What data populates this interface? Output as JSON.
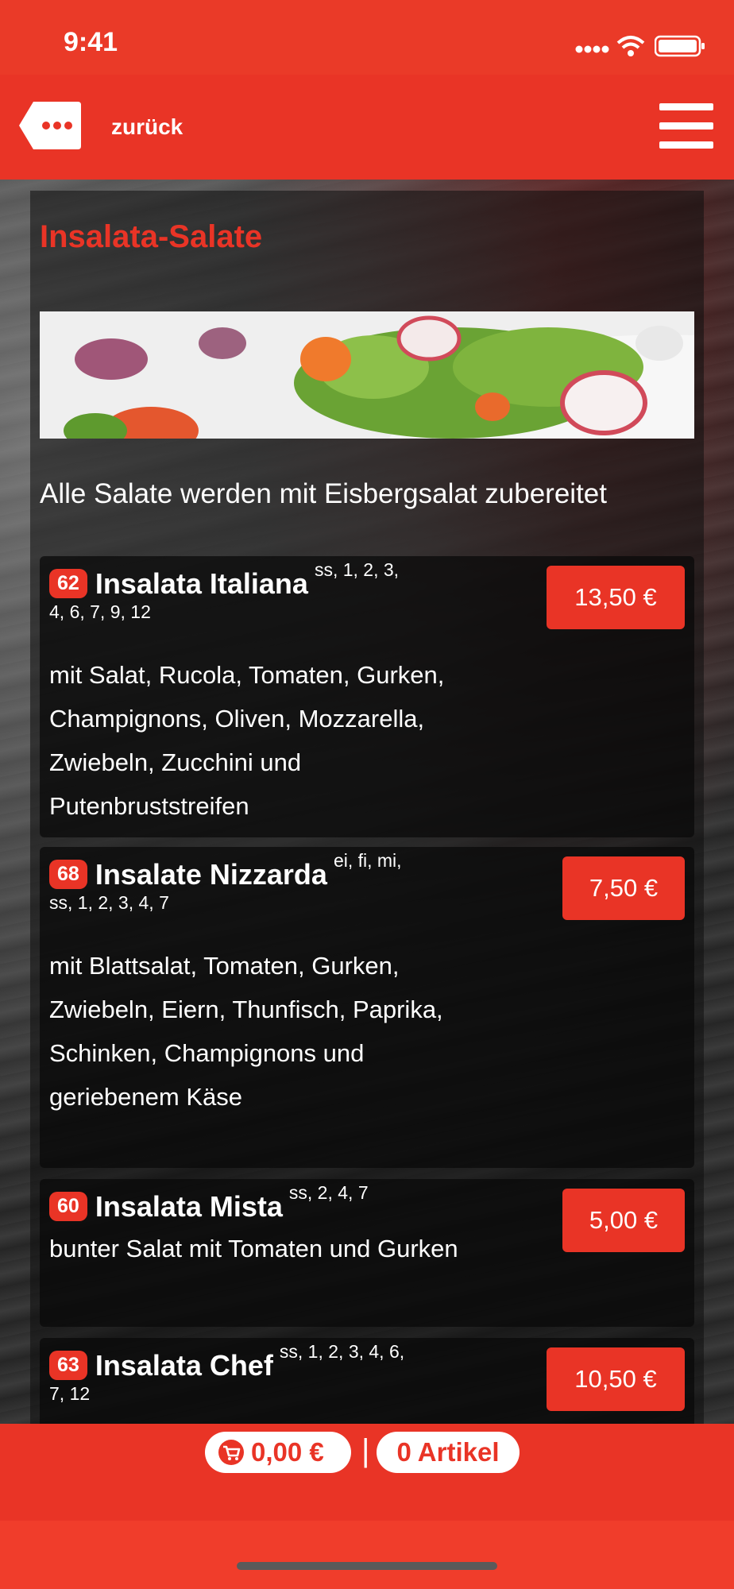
{
  "status_bar": {
    "time": "9:41"
  },
  "header": {
    "back_label": "zurück"
  },
  "section": {
    "title": "Insalata-Salate",
    "description": "Alle Salate werden mit Eisbergsalat zubereitet"
  },
  "dishes": [
    {
      "number": "62",
      "name": "Insalata Italiana",
      "allergens_inline": "ss, 1, 2, 3,",
      "allergens_line2": "4, 6, 7, 9, 12",
      "description": "mit Salat, Rucola, Tomaten, Gurken, Champignons, Oliven, Mozzarella, Zwiebeln, Zucchini und Putenbruststreifen",
      "price": "13,50 €"
    },
    {
      "number": "68",
      "name": "Insalate Nizzarda",
      "allergens_inline": "ei, fi, mi,",
      "allergens_line2": "ss, 1, 2, 3, 4, 7",
      "description": "mit Blattsalat, Tomaten, Gurken, Zwiebeln, Eiern, Thunfisch, Paprika, Schinken, Champignons und geriebenem Käse",
      "price": "7,50 €"
    },
    {
      "number": "60",
      "name": "Insalata Mista",
      "allergens_inline": "ss, 2, 4, 7",
      "allergens_line2": "",
      "description": "bunter Salat mit Tomaten und Gurken",
      "price": "5,00 €"
    },
    {
      "number": "63",
      "name": "Insalata Chef",
      "allergens_inline": "ss, 1, 2, 3, 4, 6,",
      "allergens_line2": "7, 12",
      "description": "",
      "price": "10,50 €"
    }
  ],
  "cart": {
    "total": "0,00 €",
    "separator": "|",
    "items_count": "0 Artikel"
  },
  "colors": {
    "brand": "#e93426",
    "panel": "#0f0f0f"
  },
  "icons": {
    "back": "ellipsis-tag-icon",
    "menu": "hamburger-menu-icon",
    "cart": "cart-icon"
  }
}
